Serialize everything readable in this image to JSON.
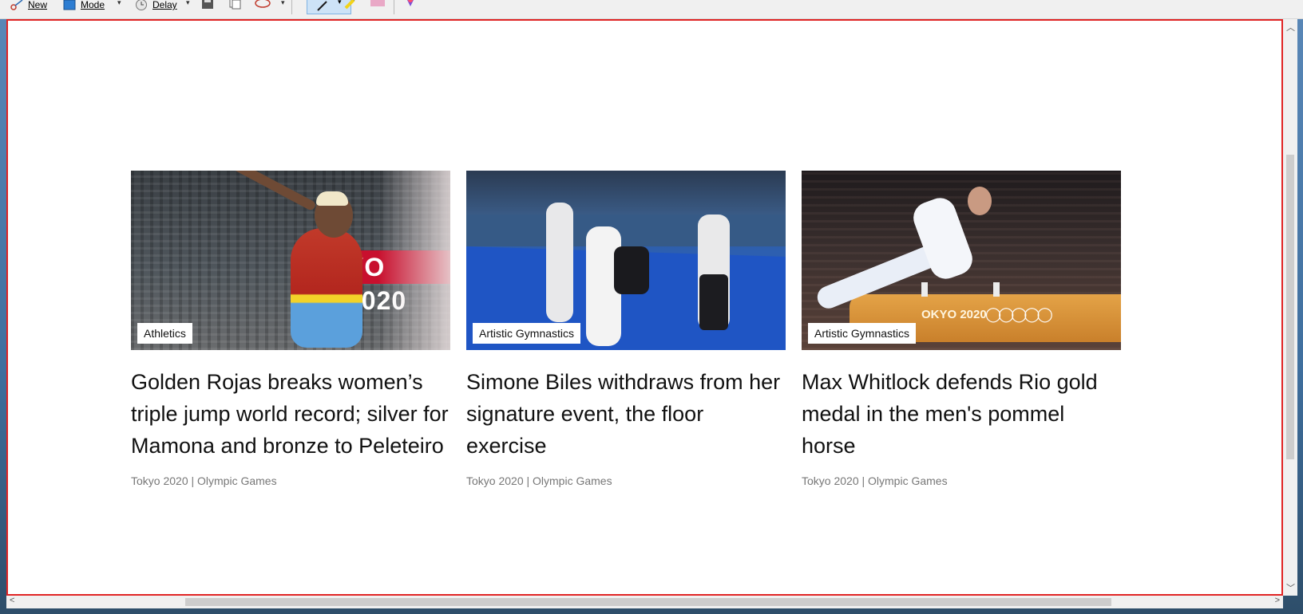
{
  "toolbar": {
    "new_label": "New",
    "mode_label": "Mode",
    "delay_label": "Delay"
  },
  "articles": [
    {
      "tag": "Athletics",
      "headline": "Golden Rojas breaks women’s triple jump world record; silver for Mamona and bronze to Peleteiro",
      "meta": "Tokyo 2020 | Olympic Games",
      "image_text": "YO 2020"
    },
    {
      "tag": "Artistic Gymnastics",
      "headline": "Simone Biles withdraws from her signature event, the floor exercise",
      "meta": "Tokyo 2020 | Olympic Games"
    },
    {
      "tag": "Artistic Gymnastics",
      "headline": "Max Whitlock defends Rio gold medal in the men's pommel horse",
      "meta": "Tokyo 2020 | Olympic Games",
      "image_text": "OKYO 2020"
    }
  ],
  "colors": {
    "frame_border": "#e02424",
    "tag_bg": "#ffffff",
    "headline": "#111111",
    "meta": "#777777"
  }
}
